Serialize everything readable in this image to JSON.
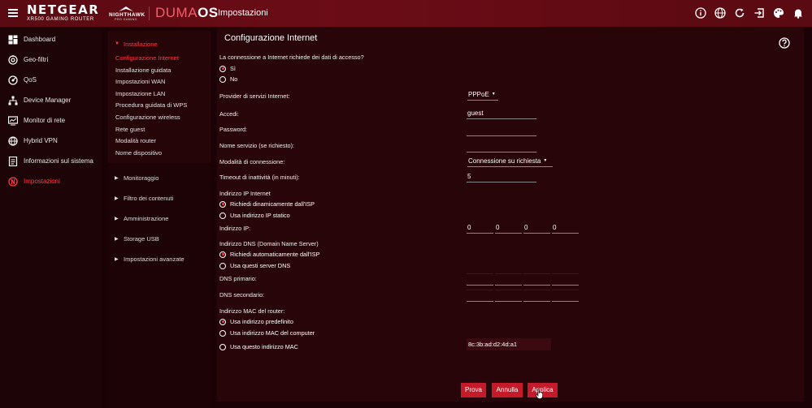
{
  "header": {
    "brand": "NETGEAR",
    "model": "XR500 GAMING ROUTER",
    "nighthawk": "NIGHTHAWK",
    "nighthawk_sub": "PRO GAMING",
    "os_part1": "DUMA",
    "os_part2": "OS",
    "page_title": "Impostazioni",
    "icons": [
      "info-icon",
      "globe-icon",
      "refresh-icon",
      "logout-icon",
      "palette-icon",
      "bell-icon"
    ]
  },
  "sidebar": {
    "items": [
      {
        "label": "Dashboard",
        "icon": "dashboard-icon"
      },
      {
        "label": "Geo-filtri",
        "icon": "geofilter-icon"
      },
      {
        "label": "QoS",
        "icon": "qos-icon"
      },
      {
        "label": "Device Manager",
        "icon": "device-manager-icon"
      },
      {
        "label": "Monitor di rete",
        "icon": "network-monitor-icon"
      },
      {
        "label": "Hybrid VPN",
        "icon": "vpn-icon"
      },
      {
        "label": "Informazioni sul sistema",
        "icon": "system-info-icon"
      },
      {
        "label": "Impostazioni",
        "icon": "settings-icon",
        "active": true
      }
    ]
  },
  "submenu": {
    "open_section": "Installazione",
    "items": [
      "Configurazione Internet",
      "Installazione guidata",
      "Impostazioni WAN",
      "Impostazione LAN",
      "Procedura guidata di WPS",
      "Configurazione wireless",
      "Rete guest",
      "Modalità router",
      "Nome dispositivo"
    ],
    "closed_sections": [
      "Monitoraggio",
      "Filtro dei contenuti",
      "Amministrazione",
      "Storage USB",
      "Impostazioni avanzate"
    ]
  },
  "form": {
    "title": "Configurazione Internet",
    "login_question": "La connessione a Internet richiede dei dati di accesso?",
    "yes": "Sì",
    "no": "No",
    "isp_label": "Provider di servizi Internet:",
    "isp_value": "PPPoE",
    "login_label": "Accedi:",
    "login_value": "guest",
    "password_label": "Password:",
    "service_label": "Nome servizio (se richiesto):",
    "conn_mode_label": "Modalità di connessione:",
    "conn_mode_value": "Connessione su richiesta",
    "timeout_label": "Timeout di inattività (in minuti):",
    "timeout_value": "5",
    "ip_section": "Indirizzo IP Internet",
    "ip_dynamic": "Richiedi dinamicamente dall'ISP",
    "ip_static": "Usa indirizzo IP statico",
    "ip_label": "Indirizzo IP:",
    "ip_values": [
      "0",
      "0",
      "0",
      "0"
    ],
    "dns_section": "Indirizzo DNS (Domain Name Server)",
    "dns_auto": "Richiedi automaticamente dall'ISP",
    "dns_manual": "Usa questi server DNS",
    "dns_primary_label": "DNS primario:",
    "dns_secondary_label": "DNS secondario:",
    "mac_section": "Indirizzo MAC del router:",
    "mac_default": "Usa indirizzo predefinito",
    "mac_computer": "Usa indirizzo MAC del computer",
    "mac_this": "Usa questo indirizzo MAC",
    "mac_value": "8c:3b:ad:d2:4d:a1"
  },
  "buttons": {
    "test": "Prova",
    "cancel": "Annulla",
    "apply": "Applica"
  },
  "colors": {
    "accent": "#ff3b48",
    "button": "#c41a2a",
    "panel": "#280509"
  }
}
